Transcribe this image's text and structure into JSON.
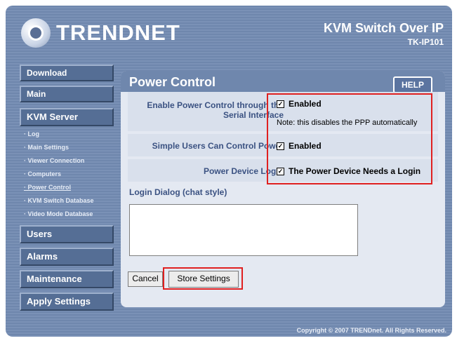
{
  "brand": {
    "logo_text": "TRENDNET"
  },
  "product": {
    "title": "KVM Switch Over IP",
    "model": "TK-IP101"
  },
  "sidebar": {
    "download": "Download",
    "main": "Main",
    "kvm_server": "KVM Server",
    "sub_items": [
      "Log",
      "Main Settings",
      "Viewer Connection",
      "Computers",
      "Power Control",
      "KVM Switch Database",
      "Video Mode Database"
    ],
    "users": "Users",
    "alarms": "Alarms",
    "maintenance": "Maintenance",
    "apply_settings": "Apply Settings"
  },
  "panel": {
    "title": "Power Control",
    "help": "HELP"
  },
  "form": {
    "enable_label_1": "Enable Power Control through the",
    "enable_label_2": "Serial Interface",
    "enable_value": "Enabled",
    "note": "Note: this disables the PPP automatically",
    "simple_users_label": "Simple Users Can Control Power",
    "simple_users_value": "Enabled",
    "device_login_label": "Power Device Login",
    "device_login_value": "The Power Device Needs a Login",
    "login_dialog_label": "Login Dialog (chat style)",
    "cancel": "Cancel",
    "store": "Store Settings"
  },
  "footer": {
    "copyright": "Copyright © 2007 TRENDnet. All Rights Reserved."
  },
  "colors": {
    "accent": "#6f87ad",
    "highlight": "#e02020"
  }
}
